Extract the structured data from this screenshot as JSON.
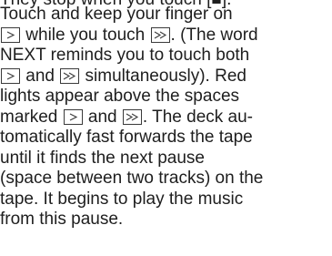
{
  "partial_top_text": "They stop when you touch [■].",
  "paragraph": {
    "l1": "Touch and keep your finger on",
    "l2_b": "while you touch",
    "l2_c": ". (The word",
    "l3": "NEXT reminds you to touch both",
    "l4_b": "and",
    "l4_c": "simultaneously). Red",
    "l5": "lights appear above the spaces",
    "l6_a": "marked",
    "l6_b": "and",
    "l6_c": ". The deck au-",
    "l7": "tomatically fast forwards the tape",
    "l8": "until it finds the next pause",
    "l9": "(space between two tracks) on the",
    "l10": "tape. It begins to play the music",
    "l11": "from this pause."
  },
  "icons": {
    "play": "play-key-icon",
    "fast_forward": "fast-forward-key-icon"
  }
}
